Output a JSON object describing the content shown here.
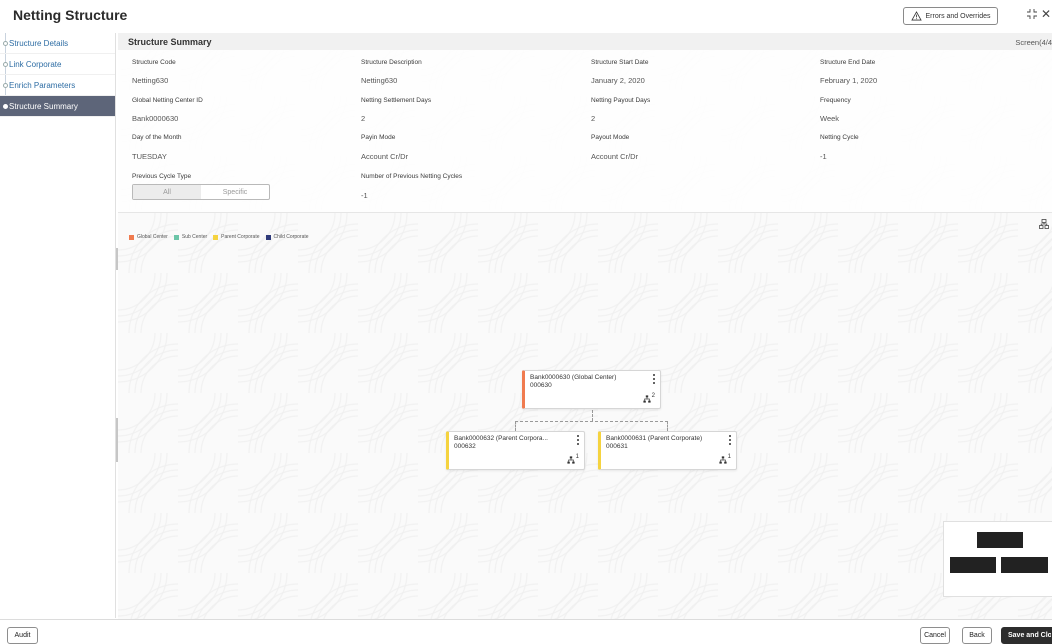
{
  "header": {
    "title": "Netting Structure",
    "errors_label": "Errors and Overrides"
  },
  "sidebar": {
    "items": [
      {
        "label": "Structure Details"
      },
      {
        "label": "Link Corporate"
      },
      {
        "label": "Enrich Parameters"
      },
      {
        "label": "Structure Summary"
      }
    ]
  },
  "summary": {
    "title": "Structure Summary",
    "screen": "Screen(4/4",
    "fields": {
      "structure_code": {
        "label": "Structure Code",
        "value": "Netting630"
      },
      "structure_description": {
        "label": "Structure Description",
        "value": "Netting630"
      },
      "structure_start_date": {
        "label": "Structure Start Date",
        "value": "January 2, 2020"
      },
      "structure_end_date": {
        "label": "Structure End Date",
        "value": "February 1, 2020"
      },
      "global_netting_center_id": {
        "label": "Global Netting Center ID",
        "value": "Bank0000630"
      },
      "netting_settlement_days": {
        "label": "Netting Settlement Days",
        "value": "2"
      },
      "netting_payout_days": {
        "label": "Netting Payout Days",
        "value": "2"
      },
      "frequency": {
        "label": "Frequency",
        "value": "Week"
      },
      "day_of_month": {
        "label": "Day of the Month",
        "value": "TUESDAY"
      },
      "payin_mode": {
        "label": "Payin Mode",
        "value": "Account Cr/Dr"
      },
      "payout_mode": {
        "label": "Payout Mode",
        "value": "Account Cr/Dr"
      },
      "netting_cycle": {
        "label": "Netting Cycle",
        "value": "-1"
      },
      "previous_cycle_type": {
        "label": "Previous Cycle Type",
        "options": [
          "All",
          "Specific"
        ],
        "selected": "All"
      },
      "previous_netting_cycles": {
        "label": "Number of Previous Netting Cycles",
        "value": "-1"
      }
    }
  },
  "legend": [
    {
      "label": "Global Center",
      "color": "#f07b4f"
    },
    {
      "label": "Sub Center",
      "color": "#6cc5a8"
    },
    {
      "label": "Parent Corporate",
      "color": "#f5d33f"
    },
    {
      "label": "Child Corporate",
      "color": "#2e3a7a"
    }
  ],
  "tree": {
    "root": {
      "name": "Bank0000630 (Global Center)",
      "code": "000630",
      "children_count": "2",
      "color": "#f07b4f"
    },
    "children": [
      {
        "name": "Bank0000632 (Parent Corpora...",
        "code": "000632",
        "children_count": "1",
        "color": "#f5d33f"
      },
      {
        "name": "Bank0000631 (Parent Corporate)",
        "code": "000631",
        "children_count": "1",
        "color": "#f5d33f"
      }
    ]
  },
  "footer": {
    "audit": "Audit",
    "cancel": "Cancel",
    "back": "Back",
    "save_close": "Save and Clos"
  }
}
